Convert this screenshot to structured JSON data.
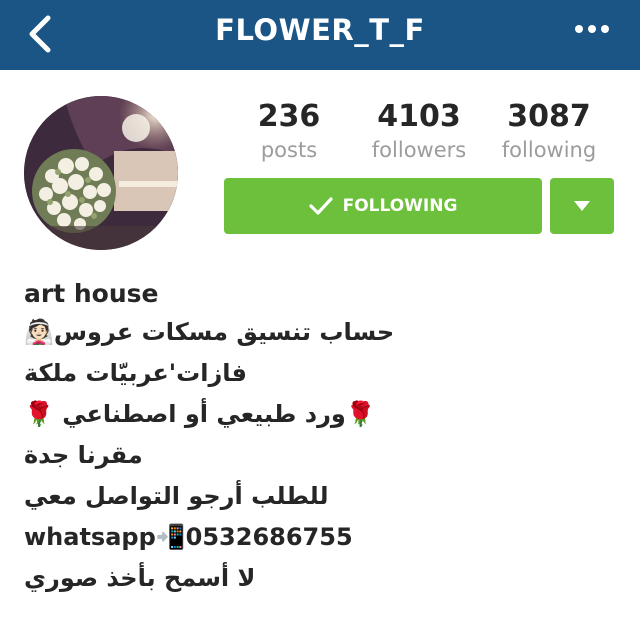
{
  "header": {
    "username": "FLOWER_T_F",
    "back_icon": "chevron-left-icon",
    "more_icon": "more-horizontal-icon",
    "background": "#1a5585"
  },
  "profile": {
    "avatar_icon": "profile-photo-flower-bouquet",
    "stats": [
      {
        "value": "236",
        "label": "posts"
      },
      {
        "value": "4103",
        "label": "followers"
      },
      {
        "value": "3087",
        "label": "following"
      }
    ],
    "follow_button": {
      "label": "FOLLOWING",
      "icon": "checkmark-icon",
      "color": "#6cc03c"
    },
    "dropdown_icon": "caret-down-icon"
  },
  "bio": {
    "name": "art house",
    "lines": [
      "حساب تنسيق مسكات عروس👰🏻",
      "فازات'عربيّات ملكة",
      "🌹ورد طبيعي أو اصطناعي 🌹",
      "مقرنا جدة",
      "للطلب أرجو التواصل معي",
      "whatsapp📲0532686755",
      "لا أسمح بأخذ صوري"
    ]
  }
}
